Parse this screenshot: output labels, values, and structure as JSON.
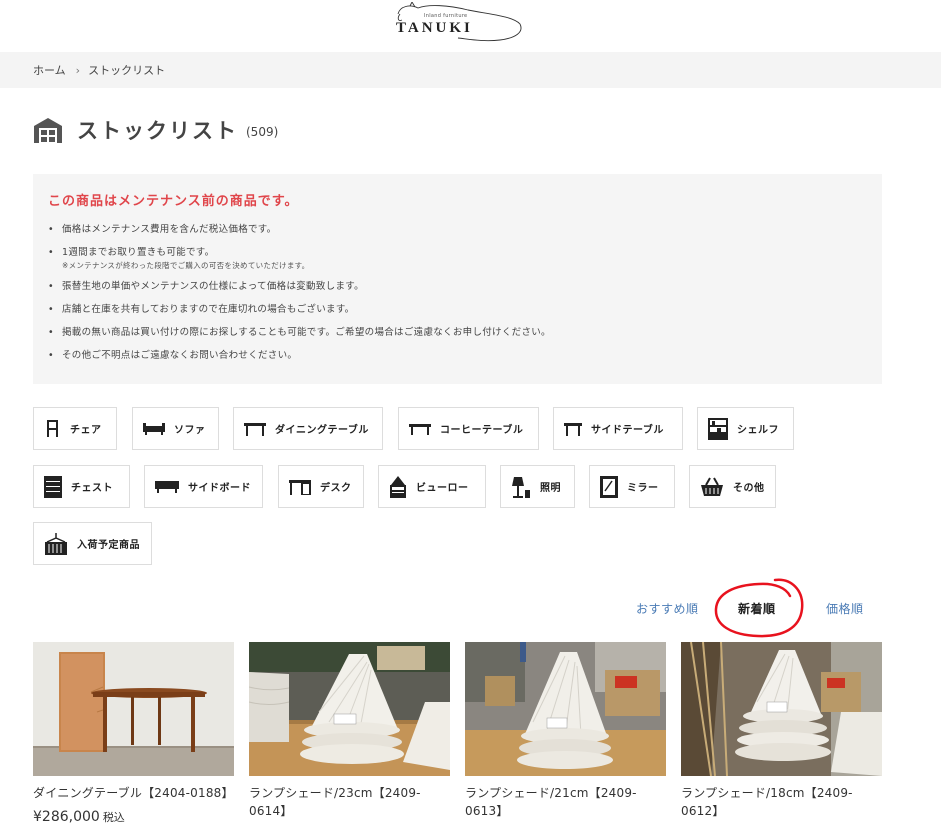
{
  "logo": {
    "main": "TANUKI",
    "sub": "Inland furniture"
  },
  "breadcrumb": {
    "home": "ホーム",
    "current": "ストックリスト"
  },
  "title": {
    "text": "ストックリスト",
    "count": "(509)"
  },
  "notice": {
    "title": "この商品はメンテナンス前の商品です。",
    "items": [
      "価格はメンテナンス費用を含んだ税込価格です。",
      "1週間までお取り置きも可能です。",
      "張替生地の単価やメンテナンスの仕様によって価格は変動致します。",
      "店舗と在庫を共有しておりますので在庫切れの場合もございます。",
      "掲載の無い商品は買い付けの際にお探しすることも可能です。ご希望の場合はご遠慮なくお申し付けください。",
      "その他ご不明点はご遠慮なくお問い合わせください。"
    ],
    "item1_sub": "※メンテナンスが終わった段階でご購入の可否を決めていただけます。"
  },
  "categories": [
    {
      "label": "チェア",
      "icon": "chair-icon"
    },
    {
      "label": "ソファ",
      "icon": "sofa-icon"
    },
    {
      "label": "ダイニングテーブル",
      "icon": "dining-table-icon"
    },
    {
      "label": "コーヒーテーブル",
      "icon": "coffee-table-icon"
    },
    {
      "label": "サイドテーブル",
      "icon": "side-table-icon"
    },
    {
      "label": "シェルフ",
      "icon": "shelf-icon"
    },
    {
      "label": "チェスト",
      "icon": "chest-icon"
    },
    {
      "label": "サイドボード",
      "icon": "sideboard-icon"
    },
    {
      "label": "デスク",
      "icon": "desk-icon"
    },
    {
      "label": "ビューロー",
      "icon": "bureau-icon"
    },
    {
      "label": "照明",
      "icon": "lamp-icon"
    },
    {
      "label": "ミラー",
      "icon": "mirror-icon"
    },
    {
      "label": "その他",
      "icon": "basket-icon"
    },
    {
      "label": "入荷予定商品",
      "icon": "container-icon"
    }
  ],
  "sort": {
    "recommended": "おすすめ順",
    "newest": "新着順",
    "price": "価格順"
  },
  "products": [
    {
      "name": "ダイニングテーブル【2404-0188】",
      "price": "¥286,000",
      "tax": "税込"
    },
    {
      "name": "ランプシェード/23cm【2409-0614】"
    },
    {
      "name": "ランプシェード/21cm【2409-0613】"
    },
    {
      "name": "ランプシェード/18cm【2409-0612】"
    }
  ],
  "colors": {
    "notice_title": "#e0464b",
    "sort_link": "#4a7bb5",
    "highlight_circle": "#e8121e",
    "breadcrumb_bg": "#f4f4f4"
  }
}
